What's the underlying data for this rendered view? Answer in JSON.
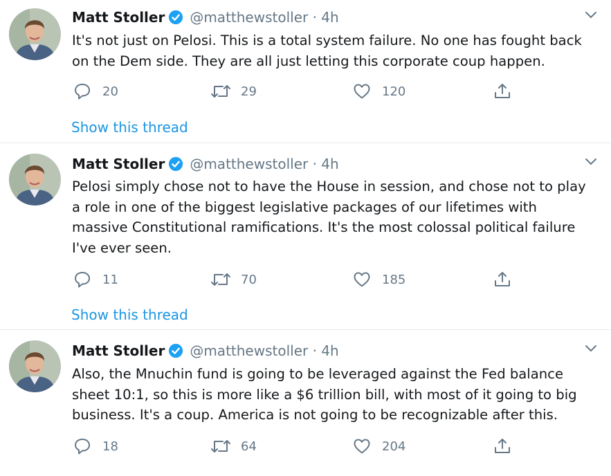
{
  "colors": {
    "accent": "#1b95e0",
    "secondary_text": "#657786",
    "divider": "#e6ecf0",
    "verified": "#1da1f2"
  },
  "icons": {
    "reply": "speech-bubble",
    "retweet": "retweet-arrows",
    "like": "heart",
    "share": "upload-arrow",
    "menu": "chevron-down",
    "verified": "check-badge"
  },
  "tweets": [
    {
      "name": "Matt Stoller",
      "handle_time": "@matthewstoller · 4h",
      "text": "It's not just on Pelosi. This is a total system failure. No one has fought back\non the Dem side. They are all just letting this corporate coup happen.",
      "replies": "20",
      "retweets": "29",
      "likes": "120",
      "thread_link": "Show this thread"
    },
    {
      "name": "Matt Stoller",
      "handle_time": "@matthewstoller · 4h",
      "text": "Pelosi simply chose not to have the House in session, and chose not to play\na role in one of the biggest legislative packages of our lifetimes with\nmassive Constitutional ramifications. It's the most colossal political failure\nI've ever seen.",
      "replies": "11",
      "retweets": "70",
      "likes": "185",
      "thread_link": "Show this thread"
    },
    {
      "name": "Matt Stoller",
      "handle_time": "@matthewstoller · 4h",
      "text": "Also, the Mnuchin fund is going to be leveraged against the Fed balance\nsheet 10:1, so this is more like a $6 trillion bill, with most of it going to big\nbusiness. It's a coup. America is not going to be recognizable after this.",
      "replies": "18",
      "retweets": "64",
      "likes": "204"
    }
  ]
}
